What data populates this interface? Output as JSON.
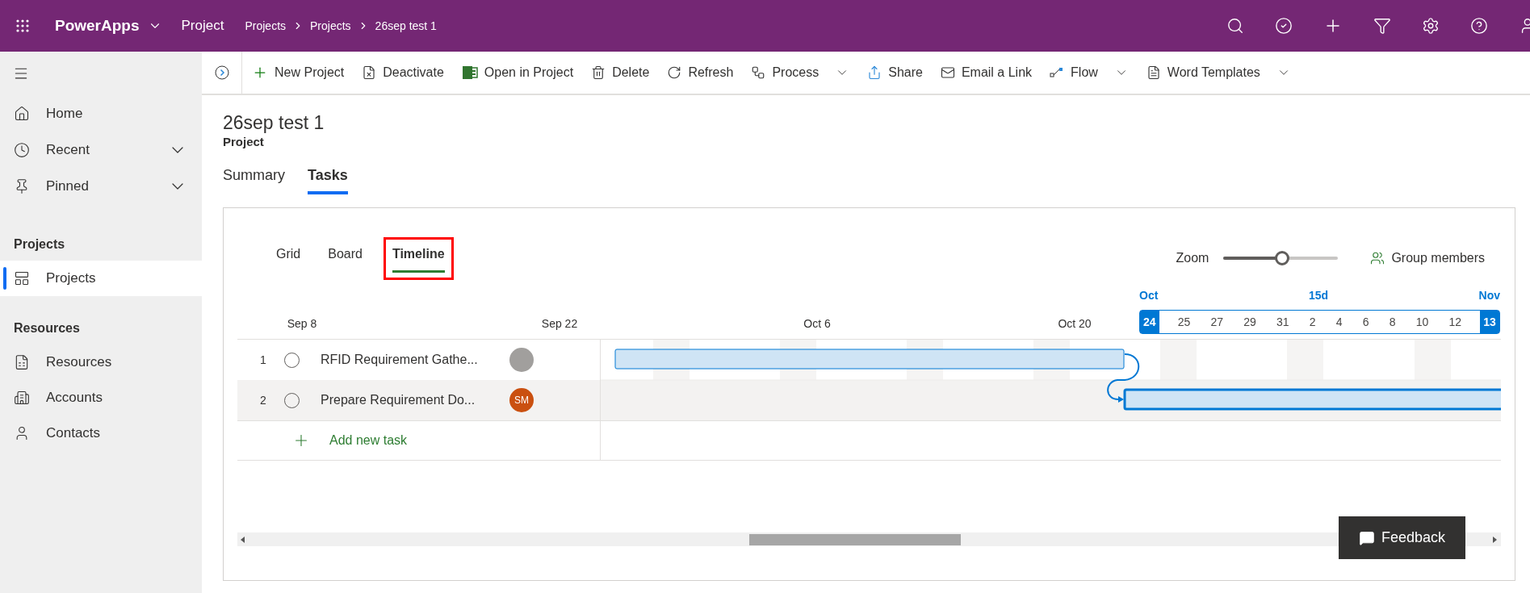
{
  "app_bar": {
    "app_name": "PowerApps",
    "area": "Project",
    "breadcrumb": [
      "Projects",
      "Projects",
      "26sep test 1"
    ]
  },
  "sidebar": {
    "top_items": [
      {
        "label": "Home",
        "expandable": false
      },
      {
        "label": "Recent",
        "expandable": true
      },
      {
        "label": "Pinned",
        "expandable": true
      }
    ],
    "sections": [
      {
        "title": "Projects",
        "items": [
          {
            "label": "Projects",
            "selected": true
          }
        ]
      },
      {
        "title": "Resources",
        "items": [
          {
            "label": "Resources",
            "selected": false
          },
          {
            "label": "Accounts",
            "selected": false
          },
          {
            "label": "Contacts",
            "selected": false
          }
        ]
      }
    ]
  },
  "toolbar": [
    {
      "label": "New Project",
      "has_menu": false
    },
    {
      "label": "Deactivate",
      "has_menu": false
    },
    {
      "label": "Open in Project",
      "has_menu": false
    },
    {
      "label": "Delete",
      "has_menu": false
    },
    {
      "label": "Refresh",
      "has_menu": false
    },
    {
      "label": "Process",
      "has_menu": true
    },
    {
      "label": "Share",
      "has_menu": false
    },
    {
      "label": "Email a Link",
      "has_menu": false
    },
    {
      "label": "Flow",
      "has_menu": true
    },
    {
      "label": "Word Templates",
      "has_menu": true
    }
  ],
  "record": {
    "title": "26sep test 1",
    "type": "Project"
  },
  "tabs": [
    {
      "label": "Summary",
      "selected": false
    },
    {
      "label": "Tasks",
      "selected": true
    }
  ],
  "view_tabs": [
    {
      "label": "Grid",
      "selected": false,
      "highlighted": false
    },
    {
      "label": "Board",
      "selected": false,
      "highlighted": false
    },
    {
      "label": "Timeline",
      "selected": true,
      "highlighted": true
    }
  ],
  "zoom": {
    "label": "Zoom",
    "level": 0.51
  },
  "group_members": "Group members",
  "timeline_dates": [
    "Sep 8",
    "Sep 22",
    "Oct 6",
    "Oct 20"
  ],
  "range": {
    "start_month": "Oct",
    "span": "15d",
    "end_month": "Nov",
    "days": [
      {
        "label": "24",
        "endpoint": true
      },
      {
        "label": "25",
        "endpoint": false
      },
      {
        "label": "27",
        "endpoint": false
      },
      {
        "label": "29",
        "endpoint": false
      },
      {
        "label": "31",
        "endpoint": false
      },
      {
        "label": "2",
        "endpoint": false
      },
      {
        "label": "4",
        "endpoint": false
      },
      {
        "label": "6",
        "endpoint": false
      },
      {
        "label": "8",
        "endpoint": false
      },
      {
        "label": "10",
        "endpoint": false
      },
      {
        "label": "12",
        "endpoint": false
      },
      {
        "label": "13",
        "endpoint": true
      }
    ]
  },
  "tasks": [
    {
      "number": "1",
      "name": "RFID Requirement Gathe...",
      "selected": false,
      "avatar": {
        "kind": "photo"
      }
    },
    {
      "number": "2",
      "name": "Prepare Requirement Do...",
      "selected": true,
      "avatar": {
        "kind": "initials",
        "text": "SM",
        "color": "#ca5010"
      }
    }
  ],
  "add_task": "Add new task",
  "feedback": "Feedback"
}
